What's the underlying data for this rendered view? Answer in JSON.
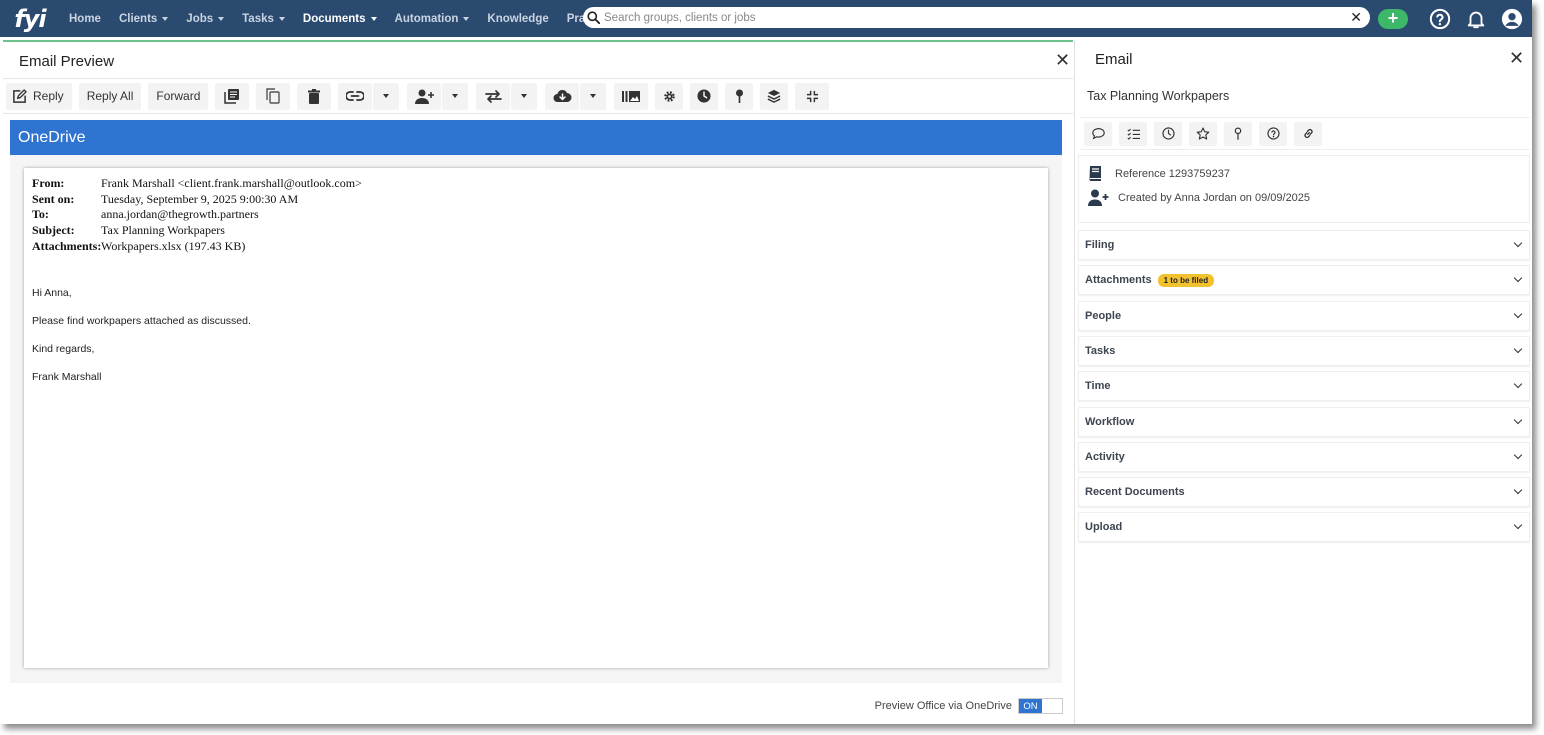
{
  "nav": {
    "logo": "fyi",
    "items": [
      {
        "label": "Home",
        "dropdown": false,
        "active": false
      },
      {
        "label": "Clients",
        "dropdown": true,
        "active": false
      },
      {
        "label": "Jobs",
        "dropdown": true,
        "active": false
      },
      {
        "label": "Tasks",
        "dropdown": true,
        "active": false
      },
      {
        "label": "Documents",
        "dropdown": true,
        "active": true
      },
      {
        "label": "Automation",
        "dropdown": true,
        "active": false
      },
      {
        "label": "Knowledge",
        "dropdown": false,
        "active": false
      },
      {
        "label": "Practice",
        "dropdown": false,
        "active": false
      }
    ],
    "search_placeholder": "Search groups, clients or jobs",
    "colors": {
      "bar": "#2b4a6f",
      "add": "#3cb868"
    }
  },
  "preview": {
    "title": "Email Preview",
    "toolbar": {
      "reply": "Reply",
      "reply_all": "Reply All",
      "forward": "Forward"
    },
    "onedrive_label": "OneDrive",
    "email": {
      "headers": [
        {
          "key": "From:",
          "value": "Frank Marshall <client.frank.marshall@outlook.com>"
        },
        {
          "key": "Sent on:",
          "value": "Tuesday, September 9, 2025 9:00:30 AM"
        },
        {
          "key": "To:",
          "value": "anna.jordan@thegrowth.partners"
        },
        {
          "key": "Subject:",
          "value": "Tax Planning Workpapers"
        },
        {
          "key": "Attachments:",
          "value": "Workpapers.xlsx (197.43 KB)"
        }
      ],
      "body": [
        "Hi Anna,",
        "Please find workpapers attached as discussed.",
        "Kind regards,",
        "Frank Marshall"
      ]
    },
    "toggle_label": "Preview Office via OneDrive",
    "toggle_state": "ON"
  },
  "details": {
    "title": "Email",
    "subject": "Tax Planning Workpapers",
    "reference": "Reference 1293759237",
    "created": "Created by Anna Jordan on 09/09/2025",
    "sections": [
      {
        "label": "Filing",
        "badge": ""
      },
      {
        "label": "Attachments",
        "badge": "1 to be filed"
      },
      {
        "label": "People",
        "badge": ""
      },
      {
        "label": "Tasks",
        "badge": ""
      },
      {
        "label": "Time",
        "badge": ""
      },
      {
        "label": "Workflow",
        "badge": ""
      },
      {
        "label": "Activity",
        "badge": ""
      },
      {
        "label": "Recent Documents",
        "badge": ""
      },
      {
        "label": "Upload",
        "badge": ""
      }
    ]
  }
}
